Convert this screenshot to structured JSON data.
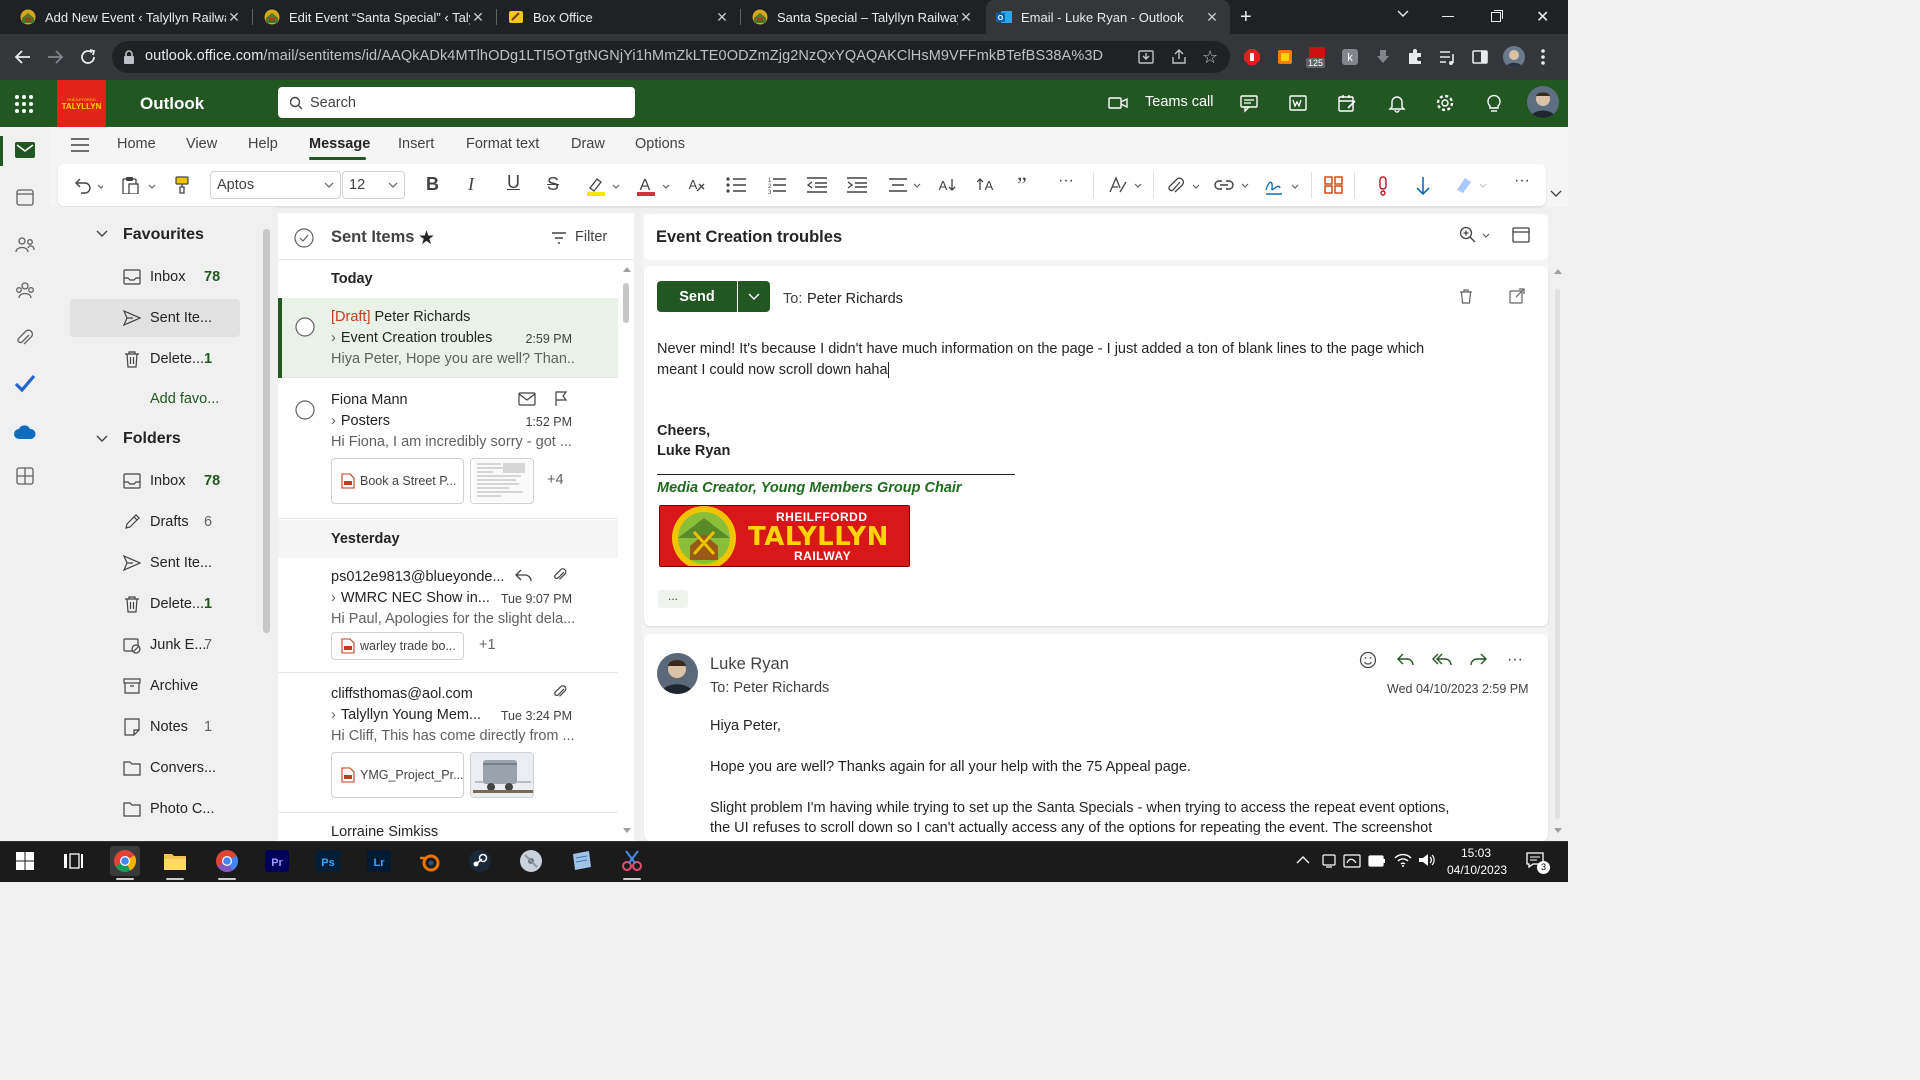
{
  "browser": {
    "tabs": [
      {
        "title": "Add New Event ‹ Talyllyn Railway",
        "active": false
      },
      {
        "title": "Edit Event “Santa Special” ‹ Talyllyn",
        "active": false
      },
      {
        "title": "Box Office",
        "active": false
      },
      {
        "title": "Santa Special – Talyllyn Railway",
        "active": false
      },
      {
        "title": "Email - Luke Ryan - Outlook",
        "active": true
      }
    ],
    "url_host": "outlook.office.com",
    "url_path": "/mail/sentitems/id/AAQkADk4MTlhODg1LTI5OTgtNGNjYi1hMmZkLTE0ODZmZjg2NzQxYQAQAKClHsM9VFFmkBTefBS38A%3D",
    "extension_badge": "125"
  },
  "outlook": {
    "app_name": "Outlook",
    "brand_color": "#225722",
    "logo_lines": [
      "RHEILFFORDD",
      "TALYLLYN"
    ],
    "search_placeholder": "Search",
    "teams_call": "Teams call"
  },
  "ribbon": {
    "tabs": [
      "Home",
      "View",
      "Help",
      "Message",
      "Insert",
      "Format text",
      "Draw",
      "Options"
    ],
    "selected": "Message",
    "font_name": "Aptos",
    "font_size": "12"
  },
  "folders": {
    "favourites_heading": "Favourites",
    "favourites": [
      {
        "label": "Inbox",
        "count": "78",
        "icon": "inbox-icon"
      },
      {
        "label": "Sent Ite...",
        "count": "",
        "icon": "send-icon"
      },
      {
        "label": "Delete...",
        "count": "1",
        "icon": "trash-icon"
      }
    ],
    "add_favourite": "Add favo...",
    "folders_heading": "Folders",
    "folders": [
      {
        "label": "Inbox",
        "count": "78",
        "icon": "inbox-icon",
        "muted": false
      },
      {
        "label": "Drafts",
        "count": "6",
        "icon": "pencil-icon",
        "muted": true
      },
      {
        "label": "Sent Ite...",
        "count": "",
        "icon": "send-icon",
        "muted": false
      },
      {
        "label": "Delete...",
        "count": "1",
        "icon": "trash-icon",
        "muted": false
      },
      {
        "label": "Junk E...",
        "count": "7",
        "icon": "junk-icon",
        "muted": true
      },
      {
        "label": "Archive",
        "count": "",
        "icon": "archive-icon",
        "muted": false
      },
      {
        "label": "Notes",
        "count": "1",
        "icon": "note-icon",
        "muted": true
      },
      {
        "label": "Convers...",
        "count": "",
        "icon": "folder-icon",
        "muted": false
      },
      {
        "label": "Photo C...",
        "count": "",
        "icon": "folder-icon",
        "muted": false
      }
    ]
  },
  "message_list": {
    "title": "Sent Items",
    "filter": "Filter",
    "groups": [
      "Today",
      "Yesterday"
    ],
    "items": [
      {
        "draft_tag": "[Draft]",
        "sender": "Peter Richards",
        "subject": "Event Creation troubles",
        "time": "2:59 PM",
        "preview": "Hiya Peter, Hope you are well? Than..."
      },
      {
        "sender": "Fiona Mann",
        "subject": "Posters",
        "time": "1:52 PM",
        "preview": "Hi Fiona, I am incredibly sorry - got ...",
        "attachment": "Book a Street P...",
        "more": "+4"
      },
      {
        "sender": "ps012e9813@blueyonde...",
        "subject": "WMRC NEC Show in...",
        "time": "Tue 9:07 PM",
        "preview": "Hi Paul, Apologies for the slight dela...",
        "attachment": "warley trade bo...",
        "more": "+1"
      },
      {
        "sender": "cliffsthomas@aol.com",
        "subject": "Talyllyn Young Mem...",
        "time": "Tue 3:24 PM",
        "preview": "Hi Cliff, This has come directly from ...",
        "attachment": "YMG_Project_Pr..."
      },
      {
        "sender": "Lorraine Simkiss"
      }
    ]
  },
  "reading": {
    "subject": "Event Creation troubles",
    "send": "Send",
    "to_label": "To:",
    "to": "Peter Richards",
    "body_line1": "Never mind! It's because I didn't have much information on the page - I just added a ton of blank lines to the page which",
    "body_line2": "meant I could now scroll down haha",
    "sig_cheers": "Cheers,",
    "sig_name": "Luke Ryan",
    "sig_title": "Media Creator, Young Members Group Chair",
    "sig_logo": [
      "RHEILFFORDD",
      "TALYLLYN",
      "RAILWAY"
    ],
    "ellipsis": "...",
    "quoted_from": "Luke Ryan",
    "quoted_to": "To: Peter Richards",
    "quoted_date": "Wed 04/10/2023 2:59 PM",
    "quoted_p1": "Hiya Peter,",
    "quoted_p2": "Hope you are well? Thanks again for all your help with the 75 Appeal page.",
    "quoted_p3a": "Slight problem I'm having while trying to set up the Santa Specials - when trying to access the repeat event options,",
    "quoted_p3b": "the UI refuses to scroll down so I can't actually access any of the options for repeating the event. The screenshot"
  },
  "taskbar": {
    "time": "15:03",
    "date": "04/10/2023",
    "notifications": "3"
  }
}
